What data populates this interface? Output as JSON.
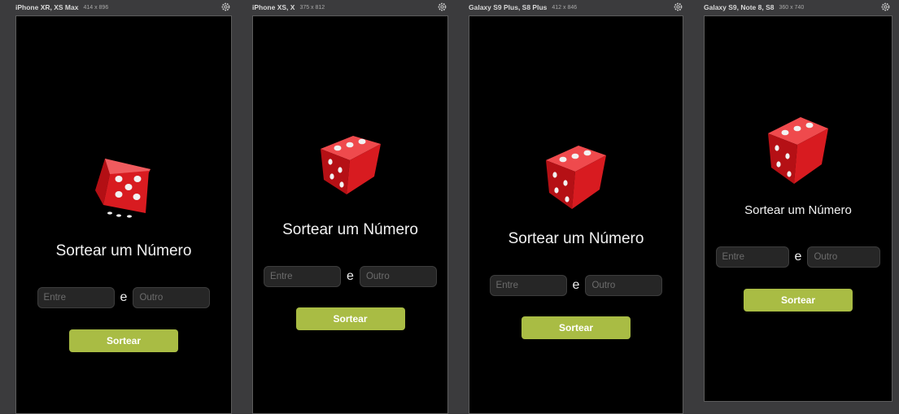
{
  "colors": {
    "panel_bg": "#3b3b3d",
    "screen_bg": "#000000",
    "accent": "#a9bc44",
    "dice_red": "#d41216"
  },
  "devices": [
    {
      "name": "iPhone XR, XS Max",
      "dims": "414 x 896"
    },
    {
      "name": "iPhone XS, X",
      "dims": "375 x 812"
    },
    {
      "name": "Galaxy S9 Plus, S8 Plus",
      "dims": "412 x 846"
    },
    {
      "name": "Galaxy S9, Note 8, S8",
      "dims": "360 x 740"
    }
  ],
  "app": {
    "title": "Sortear um Número",
    "from_placeholder": "Entre",
    "separator": "e",
    "to_placeholder": "Outro",
    "button_label": "Sortear",
    "icon": "dice-icon"
  }
}
